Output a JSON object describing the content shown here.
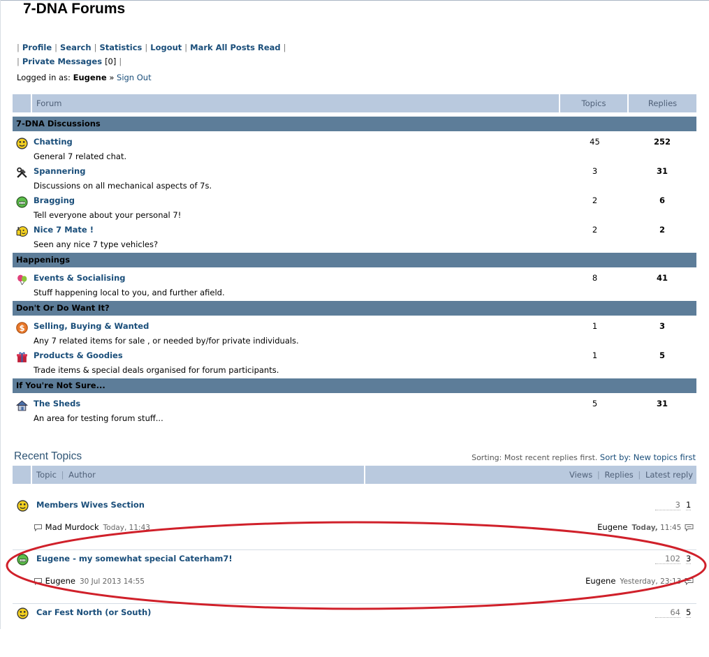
{
  "site_title": "7-DNA Forums",
  "nav": {
    "profile": "Profile",
    "search": "Search",
    "statistics": "Statistics",
    "logout": "Logout",
    "mark_all_read": "Mark All Posts Read",
    "private_messages": "Private Messages",
    "pm_count": "[0]"
  },
  "login": {
    "prefix": "Logged in as:",
    "user": "Eugene",
    "arrow": "»",
    "sign_out": "Sign Out"
  },
  "forum_table": {
    "col_forum": "Forum",
    "col_topics": "Topics",
    "col_replies": "Replies"
  },
  "categories": [
    {
      "name": "7-DNA Discussions",
      "forums": [
        {
          "name": "Chatting",
          "desc": "General 7 related chat.",
          "topics": "45",
          "replies": "252",
          "icon": "smiley-icon"
        },
        {
          "name": "Spannering",
          "desc": "Discussions on all mechanical aspects of 7s.",
          "topics": "3",
          "replies": "31",
          "icon": "tools-icon"
        },
        {
          "name": "Bragging",
          "desc": "Tell everyone about your personal 7!",
          "topics": "2",
          "replies": "6",
          "icon": "grin-icon"
        },
        {
          "name": "Nice 7 Mate !",
          "desc": "Seen any nice 7 type vehicles?",
          "topics": "2",
          "replies": "2",
          "icon": "thumbs-up-icon"
        }
      ]
    },
    {
      "name": "Happenings",
      "forums": [
        {
          "name": "Events & Socialising",
          "desc": "Stuff happening local to you, and further afield.",
          "topics": "8",
          "replies": "41",
          "icon": "balloons-icon"
        }
      ]
    },
    {
      "name": "Don't Or Do Want It?",
      "forums": [
        {
          "name": "Selling, Buying & Wanted",
          "desc": "Any 7 related items for sale , or needed by/for private individuals.",
          "topics": "1",
          "replies": "3",
          "icon": "dollar-icon"
        },
        {
          "name": "Products & Goodies",
          "desc": "Trade items & special deals organised for forum participants.",
          "topics": "1",
          "replies": "5",
          "icon": "gift-icon"
        }
      ]
    },
    {
      "name": "If You're Not Sure...",
      "forums": [
        {
          "name": "The Sheds",
          "desc": "An area for testing forum stuff...",
          "topics": "5",
          "replies": "31",
          "icon": "house-icon"
        }
      ]
    }
  ],
  "recent": {
    "title": "Recent Topics",
    "sorting_label": "Sorting: Most recent replies first.",
    "sort_by_label": "Sort by:",
    "sort_link": "New topics first",
    "col_topic": "Topic",
    "col_author": "Author",
    "col_views": "Views",
    "col_replies": "Replies",
    "col_latest": "Latest reply",
    "topics": [
      {
        "title": "Members Wives Section",
        "views": "3",
        "replies": "1",
        "author": "Mad Murdock",
        "author_date": "Today, 11:43",
        "last_user": "Eugene",
        "last_day": "Today,",
        "last_time": "11:45",
        "icon": "smiley-icon"
      },
      {
        "title": "Eugene - my somewhat special Caterham7!",
        "views": "102",
        "replies": "3",
        "author": "Eugene",
        "author_date": "30 Jul 2013 14:55",
        "last_user": "Eugene",
        "last_day": "Yesterday,",
        "last_time": "23:13",
        "icon": "grin-icon"
      },
      {
        "title": "Car Fest North (or South)",
        "views": "64",
        "replies": "5",
        "author": "",
        "author_date": "",
        "last_user": "",
        "last_day": "",
        "last_time": "",
        "icon": "smiley-icon"
      }
    ]
  },
  "colors": {
    "header_bg": "#b9c9de",
    "category_bg": "#5d7d99",
    "link": "#1a4e7a",
    "annotation": "#d0202a"
  }
}
